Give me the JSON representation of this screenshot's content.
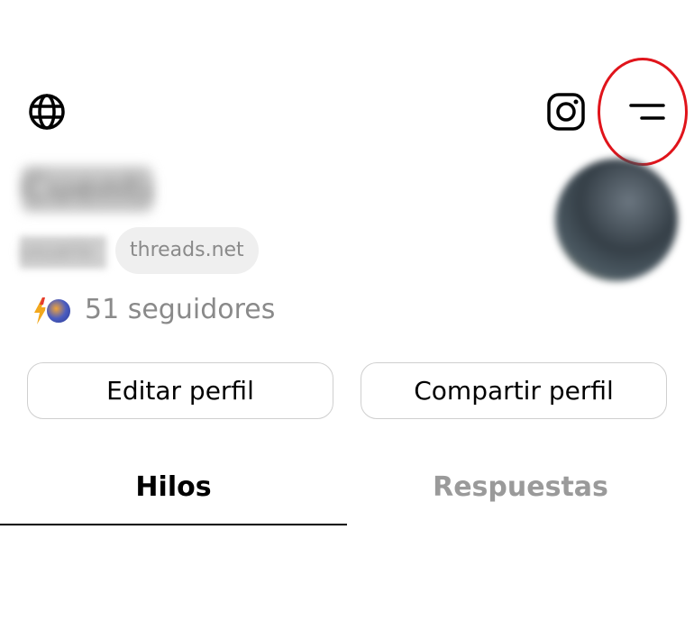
{
  "header": {
    "globe_icon": "globe-icon",
    "instagram_icon": "instagram-icon",
    "menu_icon": "menu-icon",
    "highlight_color": "#e0141b"
  },
  "profile": {
    "name": "Cuenta",
    "username": "usuario",
    "domain": "threads.net",
    "followers_label": "51 seguidores"
  },
  "actions": {
    "edit_label": "Editar perfil",
    "share_label": "Compartir perfil"
  },
  "tabs": [
    {
      "label": "Hilos",
      "active": true
    },
    {
      "label": "Respuestas",
      "active": false
    }
  ]
}
